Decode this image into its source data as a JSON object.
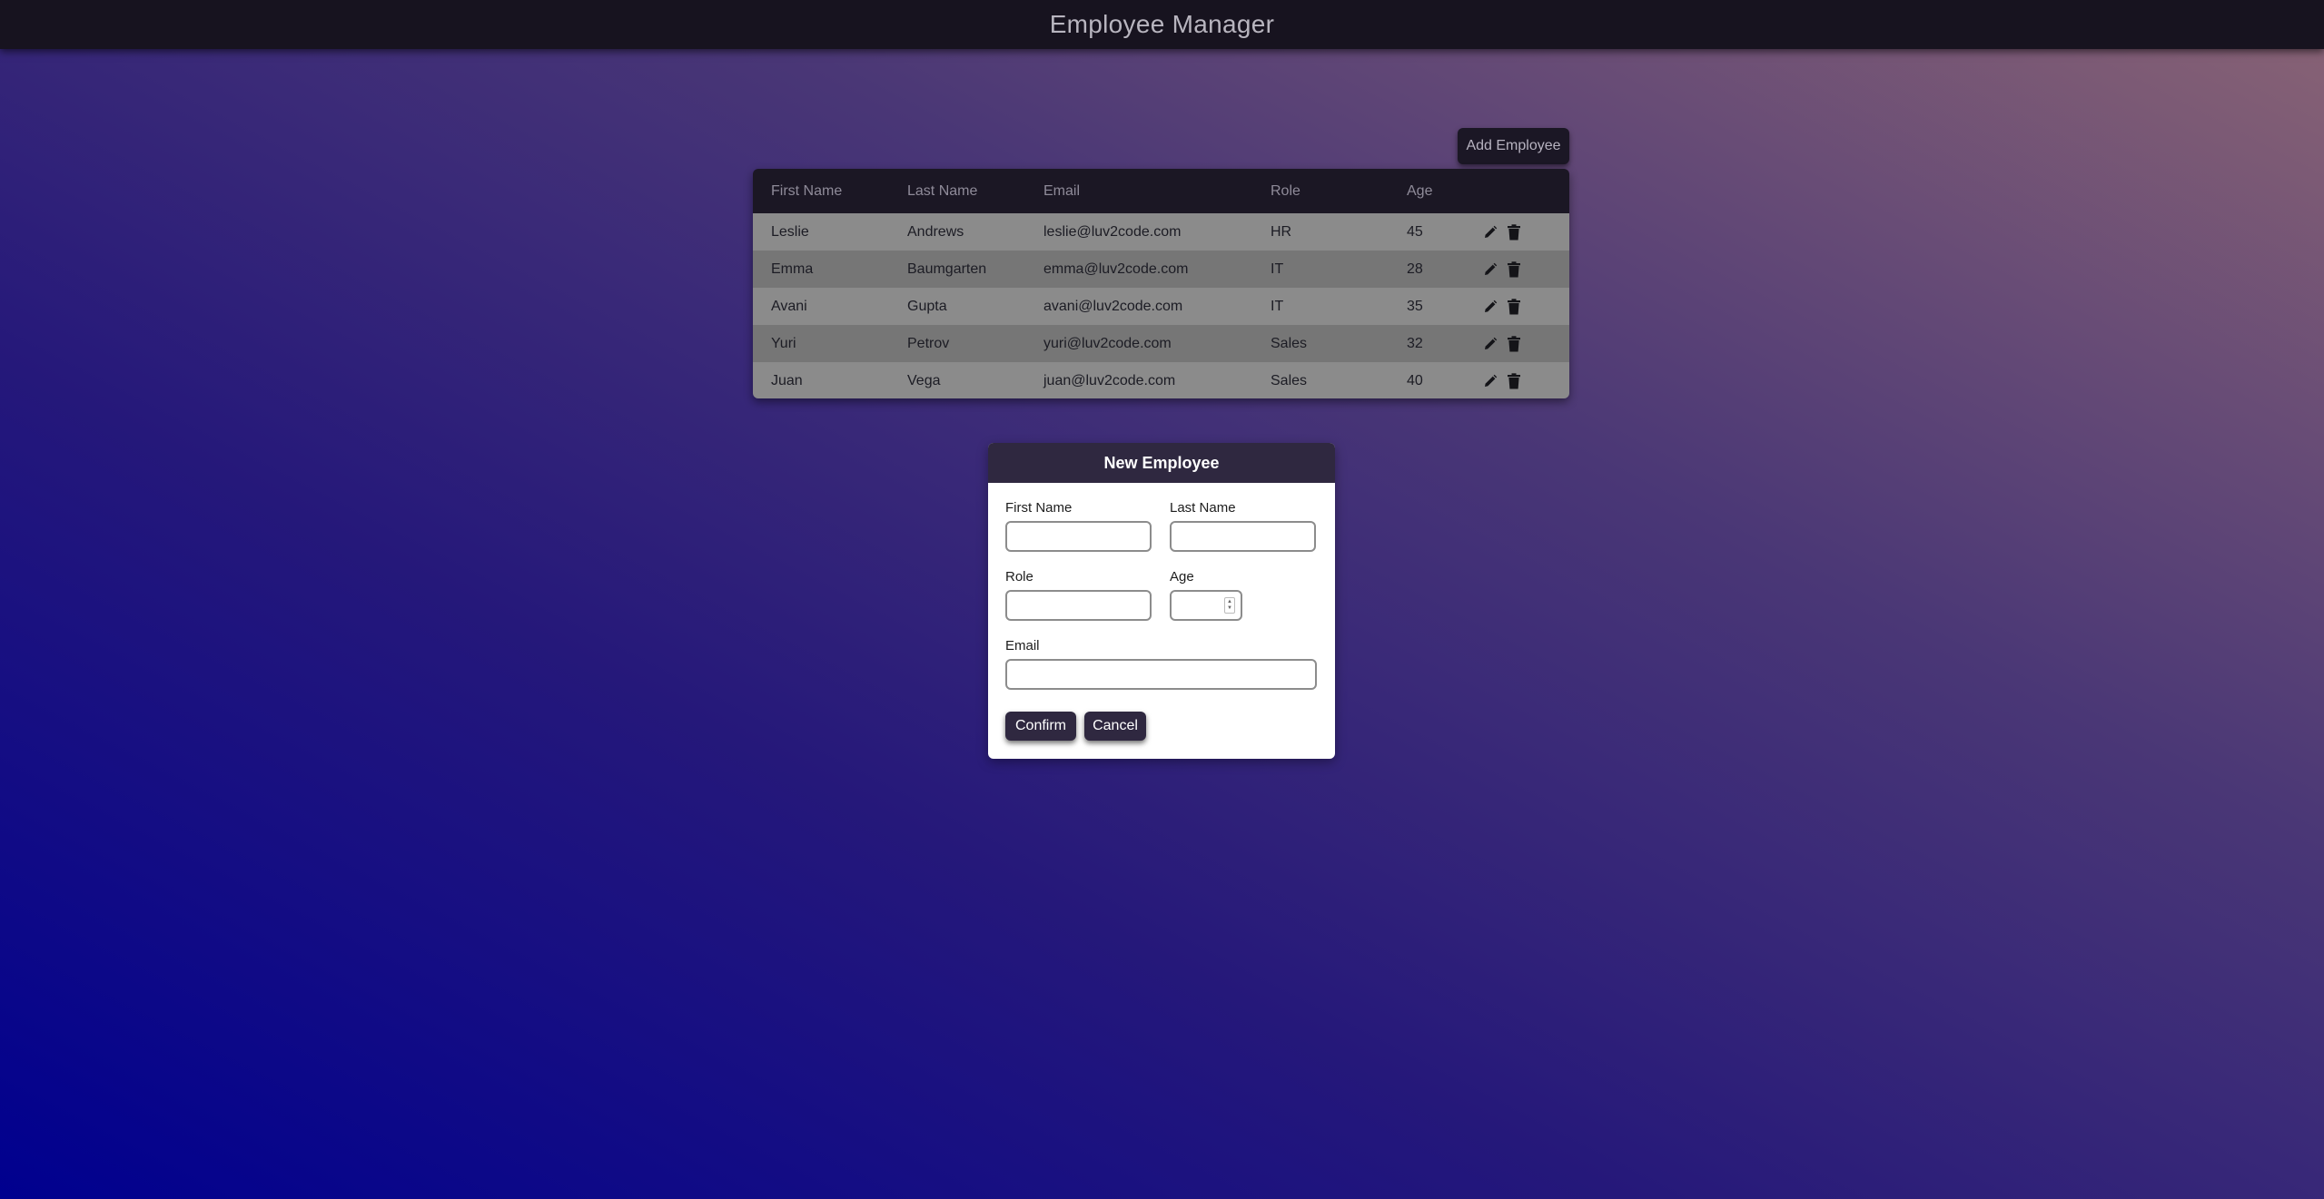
{
  "header": {
    "title": "Employee Manager"
  },
  "toolbar": {
    "add_label": "Add Employee"
  },
  "table": {
    "columns": [
      "First Name",
      "Last Name",
      "Email",
      "Role",
      "Age"
    ],
    "rows": [
      {
        "first": "Leslie",
        "last": "Andrews",
        "email": "leslie@luv2code.com",
        "role": "HR",
        "age": "45"
      },
      {
        "first": "Emma",
        "last": "Baumgarten",
        "email": "emma@luv2code.com",
        "role": "IT",
        "age": "28"
      },
      {
        "first": "Avani",
        "last": "Gupta",
        "email": "avani@luv2code.com",
        "role": "IT",
        "age": "35"
      },
      {
        "first": "Yuri",
        "last": "Petrov",
        "email": "yuri@luv2code.com",
        "role": "Sales",
        "age": "32"
      },
      {
        "first": "Juan",
        "last": "Vega",
        "email": "juan@luv2code.com",
        "role": "Sales",
        "age": "40"
      }
    ],
    "row_actions": [
      "pencil-icon",
      "trash-icon"
    ]
  },
  "dialog": {
    "title": "New Employee",
    "first_name_label": "First Name",
    "first_name_value": "",
    "last_name_label": "Last Name",
    "last_name_value": "",
    "role_label": "Role",
    "role_value": "",
    "age_label": "Age",
    "age_value": "",
    "email_label": "Email",
    "email_value": "",
    "confirm_label": "Confirm",
    "cancel_label": "Cancel"
  },
  "colors": {
    "topbar": "#17131f",
    "header_bg": "#1b1724",
    "dialog_header": "#2f2840",
    "row_odd": "#8b8b8b",
    "row_even": "#767676"
  }
}
